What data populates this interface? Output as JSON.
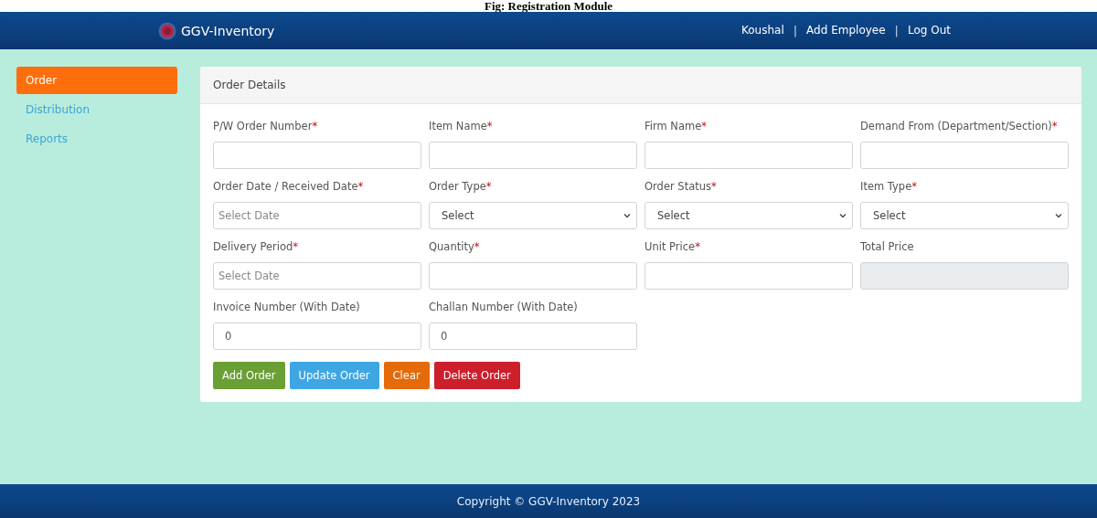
{
  "caption": "Fig: Registration Module",
  "navbar": {
    "brand": "GGV-Inventory",
    "items": [
      {
        "kind": "link",
        "text": "Koushal"
      },
      {
        "kind": "separator",
        "text": "|"
      },
      {
        "kind": "link",
        "text": "Add Employee"
      },
      {
        "kind": "separator",
        "text": "|"
      },
      {
        "kind": "link",
        "text": "Log Out"
      }
    ]
  },
  "sidebar": {
    "items": [
      {
        "label": "Order",
        "selected": true
      },
      {
        "label": "Distribution",
        "selected": false
      },
      {
        "label": "Reports",
        "selected": false
      }
    ]
  },
  "card": {
    "title": "Order Details",
    "fields": [
      {
        "kind": "text",
        "label": "P/W Order Number",
        "required_mark": "*"
      },
      {
        "kind": "text",
        "label": "Item Name",
        "required_mark": "*"
      },
      {
        "kind": "text",
        "label": "Firm Name",
        "required_mark": "*"
      },
      {
        "kind": "text",
        "label": "Demand From (Department/Section)",
        "required_mark": "*"
      },
      {
        "kind": "date",
        "label": "Order Date / Received Date",
        "required_mark": "*",
        "placeholder": "Select Date"
      },
      {
        "kind": "select",
        "label": "Order Type",
        "required_mark": "*",
        "value": "Select"
      },
      {
        "kind": "select",
        "label": "Order Status",
        "required_mark": "*",
        "value": "Select"
      },
      {
        "kind": "select",
        "label": "Item Type",
        "required_mark": "*",
        "value": "Select"
      },
      {
        "kind": "date",
        "label": "Delivery Period",
        "required_mark": "*",
        "placeholder": "Select Date"
      },
      {
        "kind": "text",
        "label": "Quantity",
        "required_mark": "*"
      },
      {
        "kind": "text",
        "label": "Unit Price",
        "required_mark": "*"
      },
      {
        "kind": "text",
        "label": "Total Price",
        "disabled": true
      },
      {
        "kind": "text",
        "label": "Invoice Number (With Date)",
        "value": "0"
      },
      {
        "kind": "text",
        "label": "Challan Number (With Date)",
        "value": "0"
      }
    ],
    "buttons": [
      {
        "label": "Add Order",
        "color": "#6a9f35"
      },
      {
        "label": "Update Order",
        "color": "#3fa6e4"
      },
      {
        "label": "Clear",
        "color": "#e56a0a"
      },
      {
        "label": "Delete Order",
        "color": "#cc1f2b"
      }
    ]
  },
  "footer": {
    "text": "Copyright © GGV-Inventory 2023"
  }
}
